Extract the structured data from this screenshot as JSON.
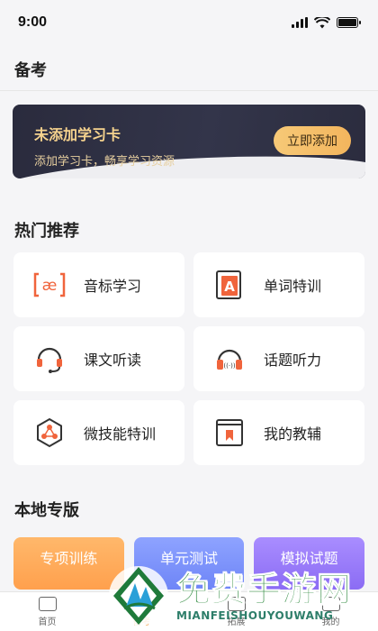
{
  "status_bar": {
    "time": "9:00"
  },
  "page": {
    "title": "备考"
  },
  "study_card": {
    "title": "未添加学习卡",
    "subtitle": "添加学习卡，畅享学习资源",
    "button": "立即添加"
  },
  "hot": {
    "title": "热门推荐",
    "items": [
      {
        "label": "音标学习",
        "icon": "phonetic-icon"
      },
      {
        "label": "单词特训",
        "icon": "word-book-icon"
      },
      {
        "label": "课文听读",
        "icon": "headset-mic-icon"
      },
      {
        "label": "话题听力",
        "icon": "headphones-icon"
      },
      {
        "label": "微技能特训",
        "icon": "hexagon-nodes-icon"
      },
      {
        "label": "我的教辅",
        "icon": "book-bookmark-icon"
      }
    ]
  },
  "local": {
    "title": "本地专版",
    "buttons": [
      {
        "label": "专项训练",
        "color": "#ffa04d"
      },
      {
        "label": "单元测试",
        "color": "#6e85f7"
      },
      {
        "label": "模拟试题",
        "color": "#8b6cf4"
      }
    ]
  },
  "tabbar": {
    "items": [
      "首页",
      "备考",
      "拓展",
      "我的"
    ],
    "active_index": 1
  },
  "watermark": {
    "cn": "免费手游网",
    "en": "MIANFEISHOUYOUWANG"
  },
  "colors": {
    "accent": "#f0a050",
    "icon_orange": "#f0643c",
    "card_dark": "#2a2b3d",
    "card_gold": "#f6d38e"
  }
}
